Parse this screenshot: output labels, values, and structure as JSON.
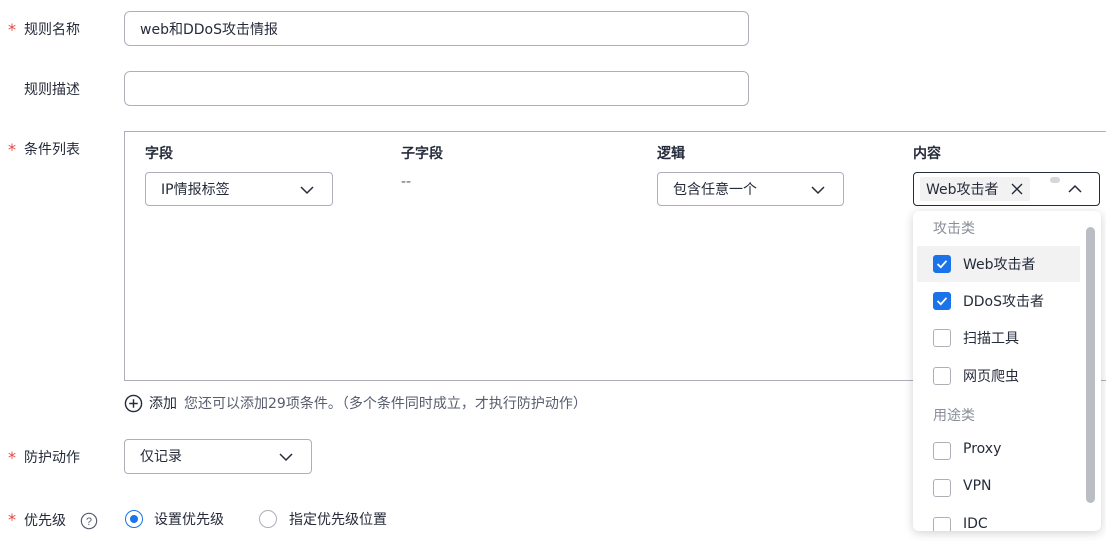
{
  "form": {
    "rule_name_label": "规则名称",
    "rule_name_value": "web和DDoS攻击情报",
    "rule_desc_label": "规则描述",
    "rule_desc_value": "",
    "conditions_label": "条件列表",
    "action_label": "防护动作",
    "priority_label": "优先级"
  },
  "conditions": {
    "headers": {
      "field": "字段",
      "subfield": "子字段",
      "logic": "逻辑",
      "content": "内容"
    },
    "row": {
      "field": "IP情报标签",
      "subfield": "--",
      "logic": "包含任意一个",
      "content_tag": "Web攻击者"
    },
    "add_label": "添加",
    "add_hint": "您还可以添加29项条件。（多个条件同时成立，才执行防护动作）"
  },
  "dropdown": {
    "groups": [
      {
        "title": "攻击类",
        "options": [
          {
            "label": "Web攻击者",
            "checked": true
          },
          {
            "label": "DDoS攻击者",
            "checked": true
          },
          {
            "label": "扫描工具",
            "checked": false
          },
          {
            "label": "网页爬虫",
            "checked": false
          }
        ]
      },
      {
        "title": "用途类",
        "options": [
          {
            "label": "Proxy",
            "checked": false
          },
          {
            "label": "VPN",
            "checked": false
          },
          {
            "label": "IDC",
            "checked": false
          }
        ]
      }
    ]
  },
  "action": {
    "value": "仅记录"
  },
  "priority": {
    "options": [
      {
        "label": "设置优先级",
        "selected": true
      },
      {
        "label": "指定优先级位置",
        "selected": false
      }
    ]
  },
  "colors": {
    "accent": "#1a73e8",
    "required": "#e54545",
    "border": "#adb0b8"
  },
  "icons": {
    "chevron": "chevron-down-icon",
    "close": "close-icon",
    "add": "plus-circle-icon",
    "help": "question-circle-icon"
  }
}
